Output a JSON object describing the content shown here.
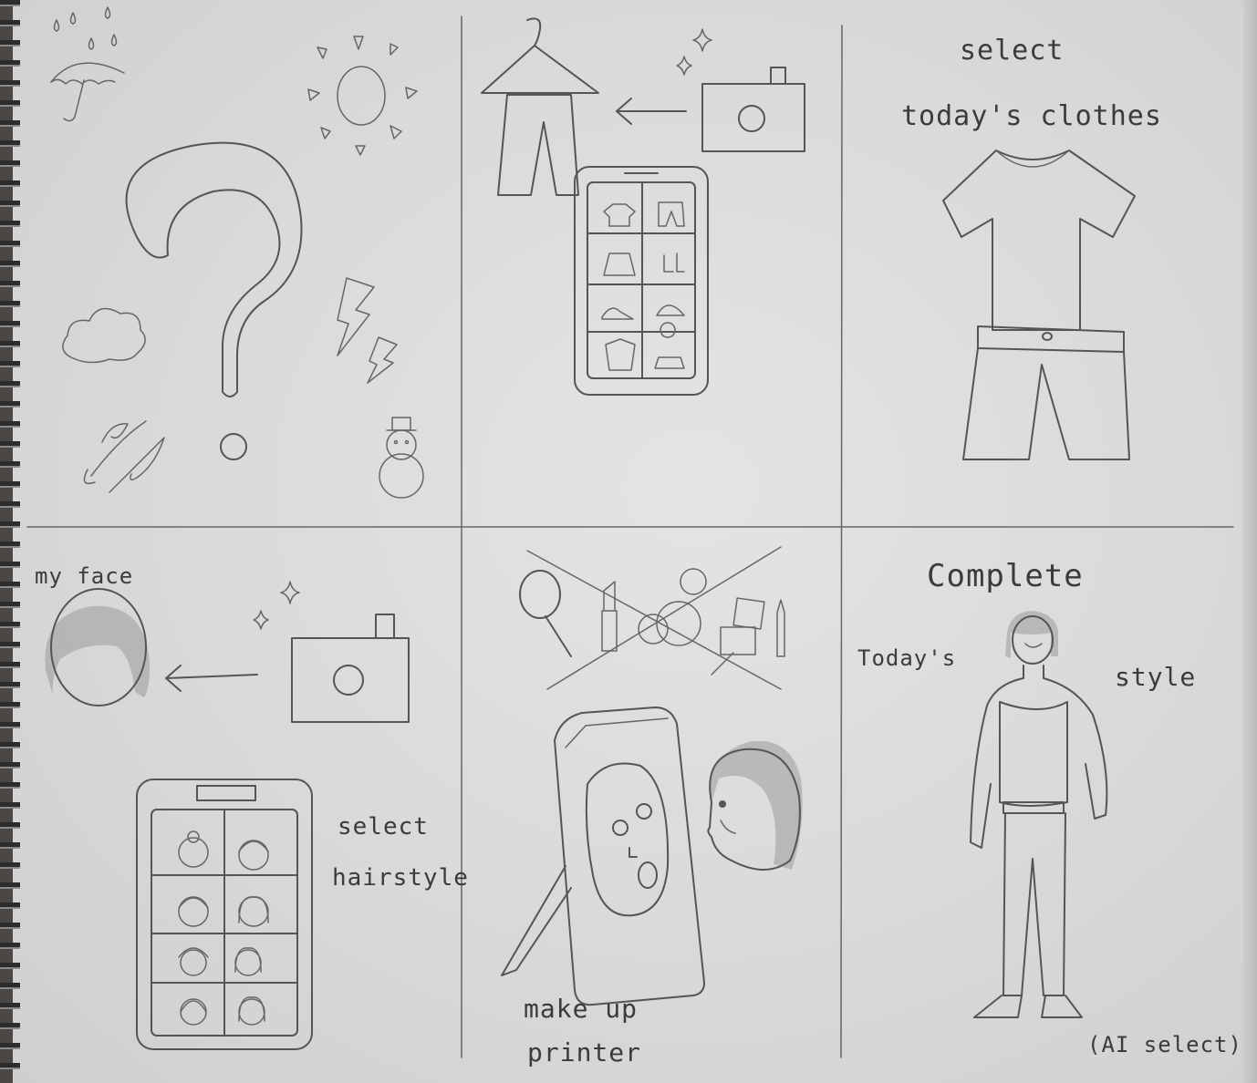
{
  "panels": {
    "top_right": {
      "line1": "select",
      "line2": "today's clothes"
    },
    "bottom_left": {
      "face_label": "my face",
      "select_line1": "select",
      "select_line2": "hairstyle"
    },
    "bottom_middle": {
      "line1": "make up",
      "line2": "printer"
    },
    "bottom_right": {
      "title": "Complete",
      "left_word": "Today's",
      "right_word": "style",
      "note": "(AI select)"
    }
  },
  "icons": {
    "weather": [
      "rain-drops",
      "umbrella",
      "sun",
      "question-mark",
      "cloud",
      "lightning",
      "wind",
      "snowman"
    ],
    "wardrobe": [
      "hanger",
      "pants",
      "camera",
      "sparkles",
      "tablet-clothing-grid"
    ],
    "outfit": [
      "t-shirt",
      "shorts"
    ],
    "face": [
      "face-with-hair",
      "camera",
      "sparkles",
      "tablet-hairstyle-grid"
    ],
    "makeup": [
      "hand-mirror",
      "lipstick",
      "compact",
      "eyeshadow-palette",
      "brush",
      "pencil",
      "cross-out"
    ],
    "printer": [
      "mask-printer",
      "person-profile"
    ],
    "final": [
      "styled-person"
    ]
  },
  "colors": {
    "paper": "#dcdcde",
    "pencil": "#555555",
    "backdrop": "#4a4744"
  }
}
